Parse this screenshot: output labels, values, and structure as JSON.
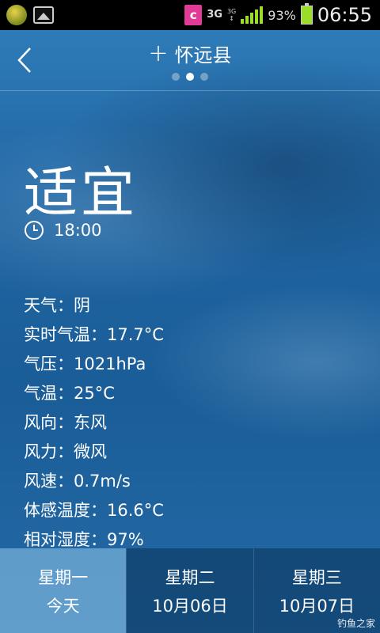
{
  "status_bar": {
    "network": "3G",
    "network_small": "3G",
    "battery_percent": "93%",
    "clock": "06:55",
    "icons": [
      "app-icon",
      "gallery-icon",
      "c-app-icon",
      "signal-icon",
      "battery-icon"
    ]
  },
  "header": {
    "city": "怀远县",
    "page_dots": 3,
    "active_dot": 1
  },
  "main": {
    "status": "适宜",
    "time": "18:00",
    "details": [
      "天气：阴",
      "实时气温：17.7°C",
      "气压：1021hPa",
      "气温：25°C",
      "风向：东风",
      "风力：微风",
      "风速：0.7m/s",
      "体感温度：16.6°C",
      "相对湿度：97%"
    ]
  },
  "tabs": [
    {
      "day": "星期一",
      "date": "今天"
    },
    {
      "day": "星期二",
      "date": "10月06日"
    },
    {
      "day": "星期三",
      "date": "10月07日"
    }
  ],
  "watermark": "钓鱼之家",
  "colors": {
    "accent": "#9bde2a",
    "sky": "#1b5f93",
    "status_bar": "#000000"
  }
}
